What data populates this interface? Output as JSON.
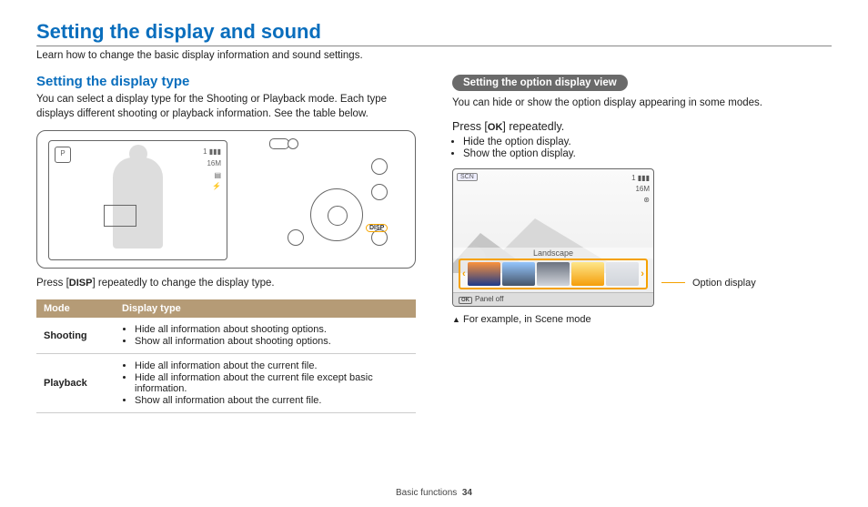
{
  "header": {
    "title": "Setting the display and sound",
    "lead": "Learn how to change the basic display information and sound settings."
  },
  "left": {
    "heading": "Setting the display type",
    "desc": "You can select a display type for the Shooting or Playback mode. Each type displays different shooting or playback information. See the table below.",
    "figure": {
      "mode_icon": "P",
      "disp_label": "DISP",
      "icons": [
        "1   ▮▮▮",
        "16M",
        "▤",
        "⚡"
      ]
    },
    "instruction": {
      "pre": "Press [",
      "key": "DISP",
      "post": "] repeatedly to change the display type."
    },
    "table": {
      "headers": [
        "Mode",
        "Display type"
      ],
      "rows": [
        {
          "mode": "Shooting",
          "items": [
            "Hide all information about shooting options.",
            "Show all information about shooting options."
          ]
        },
        {
          "mode": "Playback",
          "items": [
            "Hide all information about the current file.",
            "Hide all information about the current file except basic information.",
            "Show all information about the current file."
          ]
        }
      ]
    }
  },
  "right": {
    "pill": "Setting the option display view",
    "desc": "You can hide or show the option display appearing in some modes.",
    "instruction": {
      "pre": "Press [",
      "key": "OK",
      "post": "] repeatedly."
    },
    "effects": [
      "Hide the option display.",
      "Show the option display."
    ],
    "lcd": {
      "badge": "SCN",
      "icons": [
        "1   ▮▮▮",
        "16M",
        "⊛"
      ],
      "selected_label": "Landscape",
      "ok_icon": "OK",
      "panel_off": "Panel off"
    },
    "callout": "Option display",
    "caption": " For example, in Scene mode"
  },
  "footer": {
    "section": "Basic functions",
    "page": "34"
  }
}
